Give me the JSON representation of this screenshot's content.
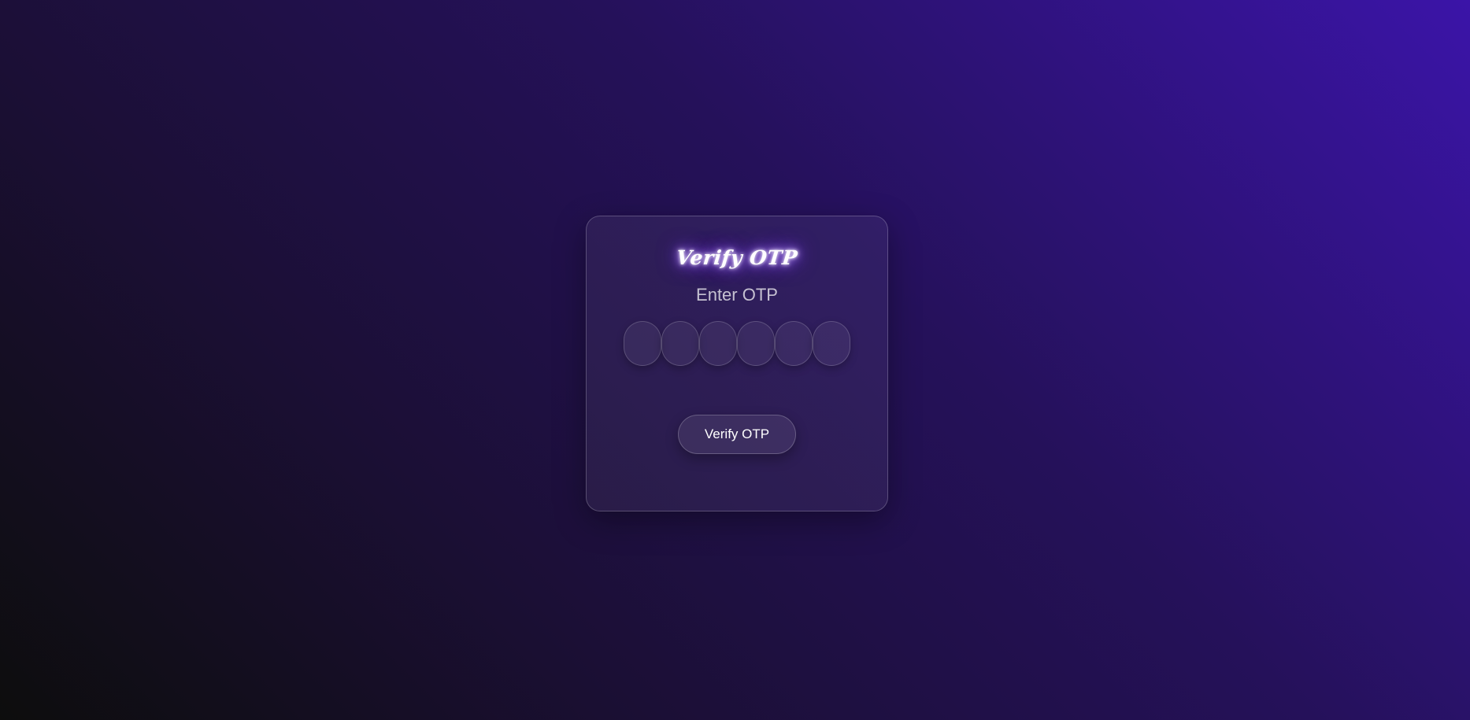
{
  "card": {
    "title": "Verify OTP",
    "subtitle": "Enter OTP",
    "otp_inputs": [
      "",
      "",
      "",
      "",
      "",
      ""
    ],
    "verify_button_label": "Verify OTP"
  },
  "colors": {
    "background_start": "#0d0d0d",
    "background_end": "#3b14a8",
    "title_glow": "#8a4dff"
  }
}
